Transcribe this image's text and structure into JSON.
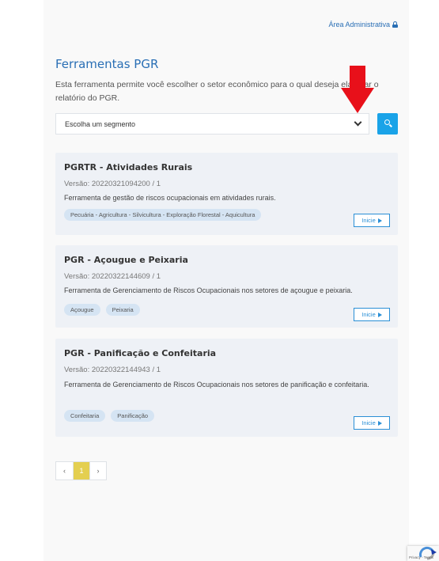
{
  "header": {
    "admin_link": "Área Administrativa"
  },
  "main": {
    "title": "Ferramentas PGR",
    "description": "Esta ferramenta permite você escolher o setor econômico para o qual deseja elaborar o relatório do PGR.",
    "segment_select": {
      "value": "Escolha um segmento"
    }
  },
  "cards": [
    {
      "title": "PGRTR - Atividades Rurais",
      "version": "Versão: 20220321094200 / 1",
      "text": "Ferramenta de gestão de riscos ocupacionais em atividades rurais.",
      "tags": [
        "Pecuária - Agricultura - Silvicultura - Exploração Florestal - Aquicultura"
      ],
      "button": "Inicie"
    },
    {
      "title": "PGR - Açougue e Peixaria",
      "version": "Versão: 20220322144609 / 1",
      "text": "Ferramenta de Gerenciamento de Riscos Ocupacionais nos setores de açougue e peixaria.",
      "tags": [
        "Açougue",
        "Peixaria"
      ],
      "button": "Inicie"
    },
    {
      "title": "PGR - Panificação e Confeitaria",
      "version": "Versão: 20220322144943 / 1",
      "text": "Ferramenta de Gerenciamento de Riscos Ocupacionais nos setores de panificação e confeitaria.",
      "tags": [
        "Confeitaria",
        "Panificação"
      ],
      "button": "Inicie"
    }
  ],
  "pagination": {
    "prev": "‹",
    "current": "1",
    "next": "›"
  },
  "recaptcha": {
    "text": "Privacy - Terms"
  },
  "colors": {
    "accent": "#2a6fb5",
    "button": "#1aa3e8",
    "active_page": "#e4cf50",
    "annotation_arrow": "#e8101a"
  }
}
